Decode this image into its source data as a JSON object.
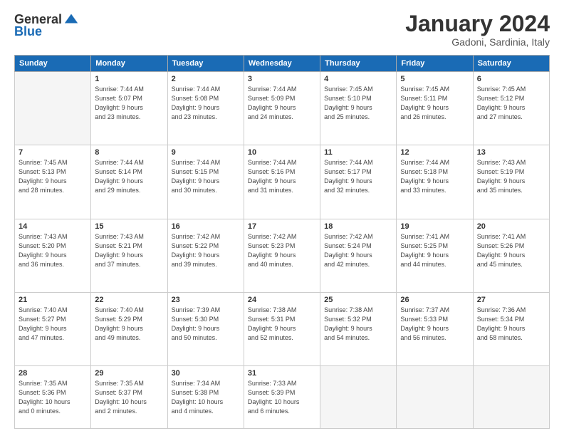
{
  "header": {
    "logo_general": "General",
    "logo_blue": "Blue",
    "month_title": "January 2024",
    "location": "Gadoni, Sardinia, Italy"
  },
  "days_of_week": [
    "Sunday",
    "Monday",
    "Tuesday",
    "Wednesday",
    "Thursday",
    "Friday",
    "Saturday"
  ],
  "weeks": [
    [
      {
        "day": "",
        "info": ""
      },
      {
        "day": "1",
        "info": "Sunrise: 7:44 AM\nSunset: 5:07 PM\nDaylight: 9 hours\nand 23 minutes."
      },
      {
        "day": "2",
        "info": "Sunrise: 7:44 AM\nSunset: 5:08 PM\nDaylight: 9 hours\nand 23 minutes."
      },
      {
        "day": "3",
        "info": "Sunrise: 7:44 AM\nSunset: 5:09 PM\nDaylight: 9 hours\nand 24 minutes."
      },
      {
        "day": "4",
        "info": "Sunrise: 7:45 AM\nSunset: 5:10 PM\nDaylight: 9 hours\nand 25 minutes."
      },
      {
        "day": "5",
        "info": "Sunrise: 7:45 AM\nSunset: 5:11 PM\nDaylight: 9 hours\nand 26 minutes."
      },
      {
        "day": "6",
        "info": "Sunrise: 7:45 AM\nSunset: 5:12 PM\nDaylight: 9 hours\nand 27 minutes."
      }
    ],
    [
      {
        "day": "7",
        "info": "Sunrise: 7:45 AM\nSunset: 5:13 PM\nDaylight: 9 hours\nand 28 minutes."
      },
      {
        "day": "8",
        "info": "Sunrise: 7:44 AM\nSunset: 5:14 PM\nDaylight: 9 hours\nand 29 minutes."
      },
      {
        "day": "9",
        "info": "Sunrise: 7:44 AM\nSunset: 5:15 PM\nDaylight: 9 hours\nand 30 minutes."
      },
      {
        "day": "10",
        "info": "Sunrise: 7:44 AM\nSunset: 5:16 PM\nDaylight: 9 hours\nand 31 minutes."
      },
      {
        "day": "11",
        "info": "Sunrise: 7:44 AM\nSunset: 5:17 PM\nDaylight: 9 hours\nand 32 minutes."
      },
      {
        "day": "12",
        "info": "Sunrise: 7:44 AM\nSunset: 5:18 PM\nDaylight: 9 hours\nand 33 minutes."
      },
      {
        "day": "13",
        "info": "Sunrise: 7:43 AM\nSunset: 5:19 PM\nDaylight: 9 hours\nand 35 minutes."
      }
    ],
    [
      {
        "day": "14",
        "info": "Sunrise: 7:43 AM\nSunset: 5:20 PM\nDaylight: 9 hours\nand 36 minutes."
      },
      {
        "day": "15",
        "info": "Sunrise: 7:43 AM\nSunset: 5:21 PM\nDaylight: 9 hours\nand 37 minutes."
      },
      {
        "day": "16",
        "info": "Sunrise: 7:42 AM\nSunset: 5:22 PM\nDaylight: 9 hours\nand 39 minutes."
      },
      {
        "day": "17",
        "info": "Sunrise: 7:42 AM\nSunset: 5:23 PM\nDaylight: 9 hours\nand 40 minutes."
      },
      {
        "day": "18",
        "info": "Sunrise: 7:42 AM\nSunset: 5:24 PM\nDaylight: 9 hours\nand 42 minutes."
      },
      {
        "day": "19",
        "info": "Sunrise: 7:41 AM\nSunset: 5:25 PM\nDaylight: 9 hours\nand 44 minutes."
      },
      {
        "day": "20",
        "info": "Sunrise: 7:41 AM\nSunset: 5:26 PM\nDaylight: 9 hours\nand 45 minutes."
      }
    ],
    [
      {
        "day": "21",
        "info": "Sunrise: 7:40 AM\nSunset: 5:27 PM\nDaylight: 9 hours\nand 47 minutes."
      },
      {
        "day": "22",
        "info": "Sunrise: 7:40 AM\nSunset: 5:29 PM\nDaylight: 9 hours\nand 49 minutes."
      },
      {
        "day": "23",
        "info": "Sunrise: 7:39 AM\nSunset: 5:30 PM\nDaylight: 9 hours\nand 50 minutes."
      },
      {
        "day": "24",
        "info": "Sunrise: 7:38 AM\nSunset: 5:31 PM\nDaylight: 9 hours\nand 52 minutes."
      },
      {
        "day": "25",
        "info": "Sunrise: 7:38 AM\nSunset: 5:32 PM\nDaylight: 9 hours\nand 54 minutes."
      },
      {
        "day": "26",
        "info": "Sunrise: 7:37 AM\nSunset: 5:33 PM\nDaylight: 9 hours\nand 56 minutes."
      },
      {
        "day": "27",
        "info": "Sunrise: 7:36 AM\nSunset: 5:34 PM\nDaylight: 9 hours\nand 58 minutes."
      }
    ],
    [
      {
        "day": "28",
        "info": "Sunrise: 7:35 AM\nSunset: 5:36 PM\nDaylight: 10 hours\nand 0 minutes."
      },
      {
        "day": "29",
        "info": "Sunrise: 7:35 AM\nSunset: 5:37 PM\nDaylight: 10 hours\nand 2 minutes."
      },
      {
        "day": "30",
        "info": "Sunrise: 7:34 AM\nSunset: 5:38 PM\nDaylight: 10 hours\nand 4 minutes."
      },
      {
        "day": "31",
        "info": "Sunrise: 7:33 AM\nSunset: 5:39 PM\nDaylight: 10 hours\nand 6 minutes."
      },
      {
        "day": "",
        "info": ""
      },
      {
        "day": "",
        "info": ""
      },
      {
        "day": "",
        "info": ""
      }
    ]
  ]
}
